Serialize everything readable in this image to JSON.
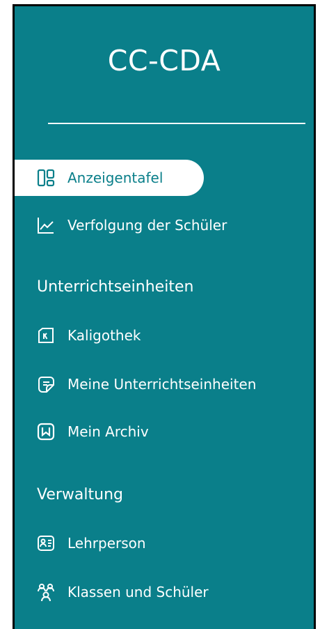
{
  "brand": {
    "title": "CC-CDA"
  },
  "nav": {
    "items": [
      {
        "label": "Anzeigentafel",
        "icon": "dashboard-icon",
        "active": true
      },
      {
        "label": "Verfolgung der Schüler",
        "icon": "chart-line-icon",
        "active": false
      }
    ]
  },
  "sections": [
    {
      "title": "Unterrichtseinheiten",
      "items": [
        {
          "label": "Kaligothek",
          "icon": "kaligothek-icon"
        },
        {
          "label": "Meine Unterrichtseinheiten",
          "icon": "sticker-icon"
        },
        {
          "label": "Mein Archiv",
          "icon": "archive-book-icon"
        }
      ]
    },
    {
      "title": "Verwaltung",
      "items": [
        {
          "label": "Lehrperson",
          "icon": "id-card-icon"
        },
        {
          "label": "Klassen und Schüler",
          "icon": "people-group-icon"
        }
      ]
    }
  ],
  "colors": {
    "sidebar": "#0a7f8a",
    "active_bg": "#ffffff",
    "text": "#ffffff"
  }
}
